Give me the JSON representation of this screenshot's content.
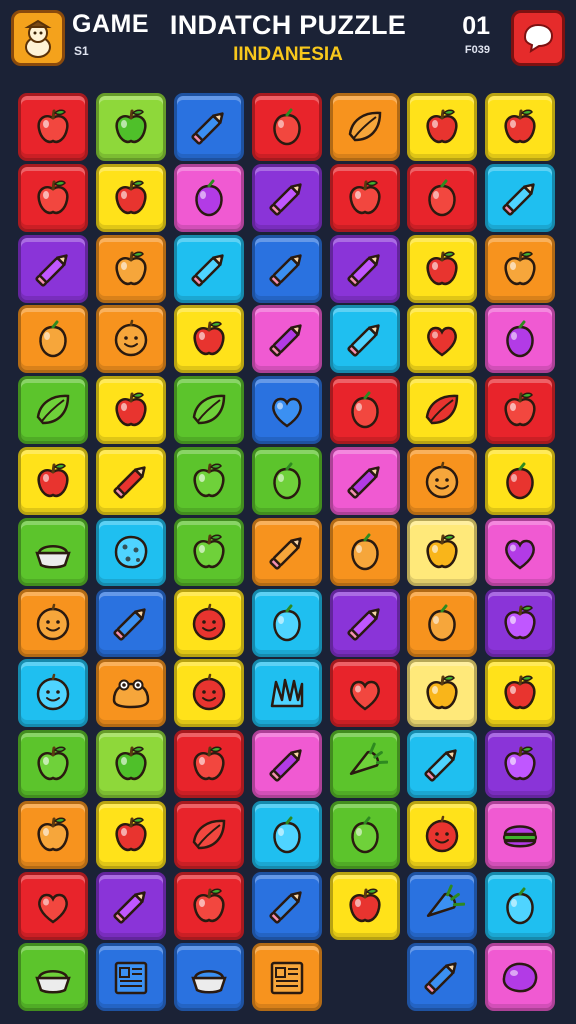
{
  "header": {
    "game_label": "GAME",
    "game_sub": "S1",
    "title": "INDATCH PUZZLE",
    "subtitle": "IINDANESIA",
    "score": "01",
    "score_sub": "F039",
    "left_icon": "character-icon",
    "right_icon": "chat-bubble-icon"
  },
  "colors": {
    "red": "#e8242b",
    "green": "#5cc42c",
    "lime": "#8ed83a",
    "blue": "#2a72e0",
    "orange": "#f7931e",
    "yellow": "#ffe21a",
    "cyan": "#1fbff0",
    "purple": "#8a34d8",
    "pink": "#f05ad2",
    "lightyellow": "#ffe97a"
  },
  "board": {
    "rows": [
      [
        {
          "color": "red",
          "icon": "apple"
        },
        {
          "color": "lime",
          "icon": "apple"
        },
        {
          "color": "blue",
          "icon": "pencil"
        },
        {
          "color": "red",
          "icon": "plum"
        },
        {
          "color": "orange",
          "icon": "leaf"
        },
        {
          "color": "yellow",
          "icon": "apple"
        },
        {
          "color": "yellow",
          "icon": "apple"
        }
      ],
      [
        {
          "color": "red",
          "icon": "apple"
        },
        {
          "color": "yellow",
          "icon": "apple"
        },
        {
          "color": "pink",
          "icon": "plum"
        },
        {
          "color": "purple",
          "icon": "pencil"
        },
        {
          "color": "red",
          "icon": "apple"
        },
        {
          "color": "red",
          "icon": "plum"
        },
        {
          "color": "cyan",
          "icon": "pencil"
        }
      ],
      [
        {
          "color": "purple",
          "icon": "pencil"
        },
        {
          "color": "orange",
          "icon": "apple"
        },
        {
          "color": "cyan",
          "icon": "pencil"
        },
        {
          "color": "blue",
          "icon": "pencil"
        },
        {
          "color": "purple",
          "icon": "pencil"
        },
        {
          "color": "yellow",
          "icon": "apple"
        },
        {
          "color": "orange",
          "icon": "apple"
        }
      ],
      [
        {
          "color": "orange",
          "icon": "plum"
        },
        {
          "color": "orange",
          "icon": "face"
        },
        {
          "color": "yellow",
          "icon": "apple"
        },
        {
          "color": "pink",
          "icon": "pencil"
        },
        {
          "color": "cyan",
          "icon": "pencil"
        },
        {
          "color": "yellow",
          "icon": "heart"
        },
        {
          "color": "pink",
          "icon": "plum"
        }
      ],
      [
        {
          "color": "green",
          "icon": "leaf"
        },
        {
          "color": "yellow",
          "icon": "apple"
        },
        {
          "color": "green",
          "icon": "leaf"
        },
        {
          "color": "blue",
          "icon": "heart"
        },
        {
          "color": "red",
          "icon": "plum"
        },
        {
          "color": "yellow",
          "icon": "leaf"
        },
        {
          "color": "red",
          "icon": "apple"
        }
      ],
      [
        {
          "color": "yellow",
          "icon": "apple"
        },
        {
          "color": "yellow",
          "icon": "pencil"
        },
        {
          "color": "green",
          "icon": "apple"
        },
        {
          "color": "green",
          "icon": "plum"
        },
        {
          "color": "pink",
          "icon": "pencil"
        },
        {
          "color": "orange",
          "icon": "face"
        },
        {
          "color": "yellow",
          "icon": "plum"
        }
      ],
      [
        {
          "color": "green",
          "icon": "pie"
        },
        {
          "color": "cyan",
          "icon": "cookie"
        },
        {
          "color": "green",
          "icon": "apple"
        },
        {
          "color": "orange",
          "icon": "pencil"
        },
        {
          "color": "orange",
          "icon": "plum"
        },
        {
          "color": "lightyellow",
          "icon": "apple"
        },
        {
          "color": "pink",
          "icon": "heart"
        }
      ],
      [
        {
          "color": "orange",
          "icon": "face"
        },
        {
          "color": "blue",
          "icon": "pencil"
        },
        {
          "color": "yellow",
          "icon": "face"
        },
        {
          "color": "cyan",
          "icon": "plum"
        },
        {
          "color": "purple",
          "icon": "pencil"
        },
        {
          "color": "orange",
          "icon": "plum"
        },
        {
          "color": "purple",
          "icon": "apple"
        }
      ],
      [
        {
          "color": "cyan",
          "icon": "face"
        },
        {
          "color": "orange",
          "icon": "frog"
        },
        {
          "color": "yellow",
          "icon": "face"
        },
        {
          "color": "cyan",
          "icon": "shell"
        },
        {
          "color": "red",
          "icon": "heart"
        },
        {
          "color": "lightyellow",
          "icon": "apple"
        },
        {
          "color": "yellow",
          "icon": "apple"
        }
      ],
      [
        {
          "color": "green",
          "icon": "apple"
        },
        {
          "color": "lime",
          "icon": "apple"
        },
        {
          "color": "red",
          "icon": "apple"
        },
        {
          "color": "pink",
          "icon": "pencil"
        },
        {
          "color": "green",
          "icon": "carrot"
        },
        {
          "color": "cyan",
          "icon": "pencil"
        },
        {
          "color": "purple",
          "icon": "apple"
        }
      ],
      [
        {
          "color": "orange",
          "icon": "apple"
        },
        {
          "color": "yellow",
          "icon": "apple"
        },
        {
          "color": "red",
          "icon": "leaf"
        },
        {
          "color": "cyan",
          "icon": "plum"
        },
        {
          "color": "green",
          "icon": "plum"
        },
        {
          "color": "yellow",
          "icon": "face"
        },
        {
          "color": "pink",
          "icon": "burger"
        }
      ],
      [
        {
          "color": "red",
          "icon": "heart"
        },
        {
          "color": "purple",
          "icon": "pencil"
        },
        {
          "color": "red",
          "icon": "apple"
        },
        {
          "color": "blue",
          "icon": "pencil"
        },
        {
          "color": "yellow",
          "icon": "apple"
        },
        {
          "color": "blue",
          "icon": "carrot"
        },
        {
          "color": "cyan",
          "icon": "plum"
        }
      ],
      [
        {
          "color": "green",
          "icon": "pie"
        },
        {
          "color": "blue",
          "icon": "newspaper"
        },
        {
          "color": "blue",
          "icon": "pie"
        },
        {
          "color": "orange",
          "icon": "newspaper"
        },
        null,
        {
          "color": "blue",
          "icon": "pencil"
        },
        {
          "color": "pink",
          "icon": "lemon"
        }
      ]
    ]
  }
}
